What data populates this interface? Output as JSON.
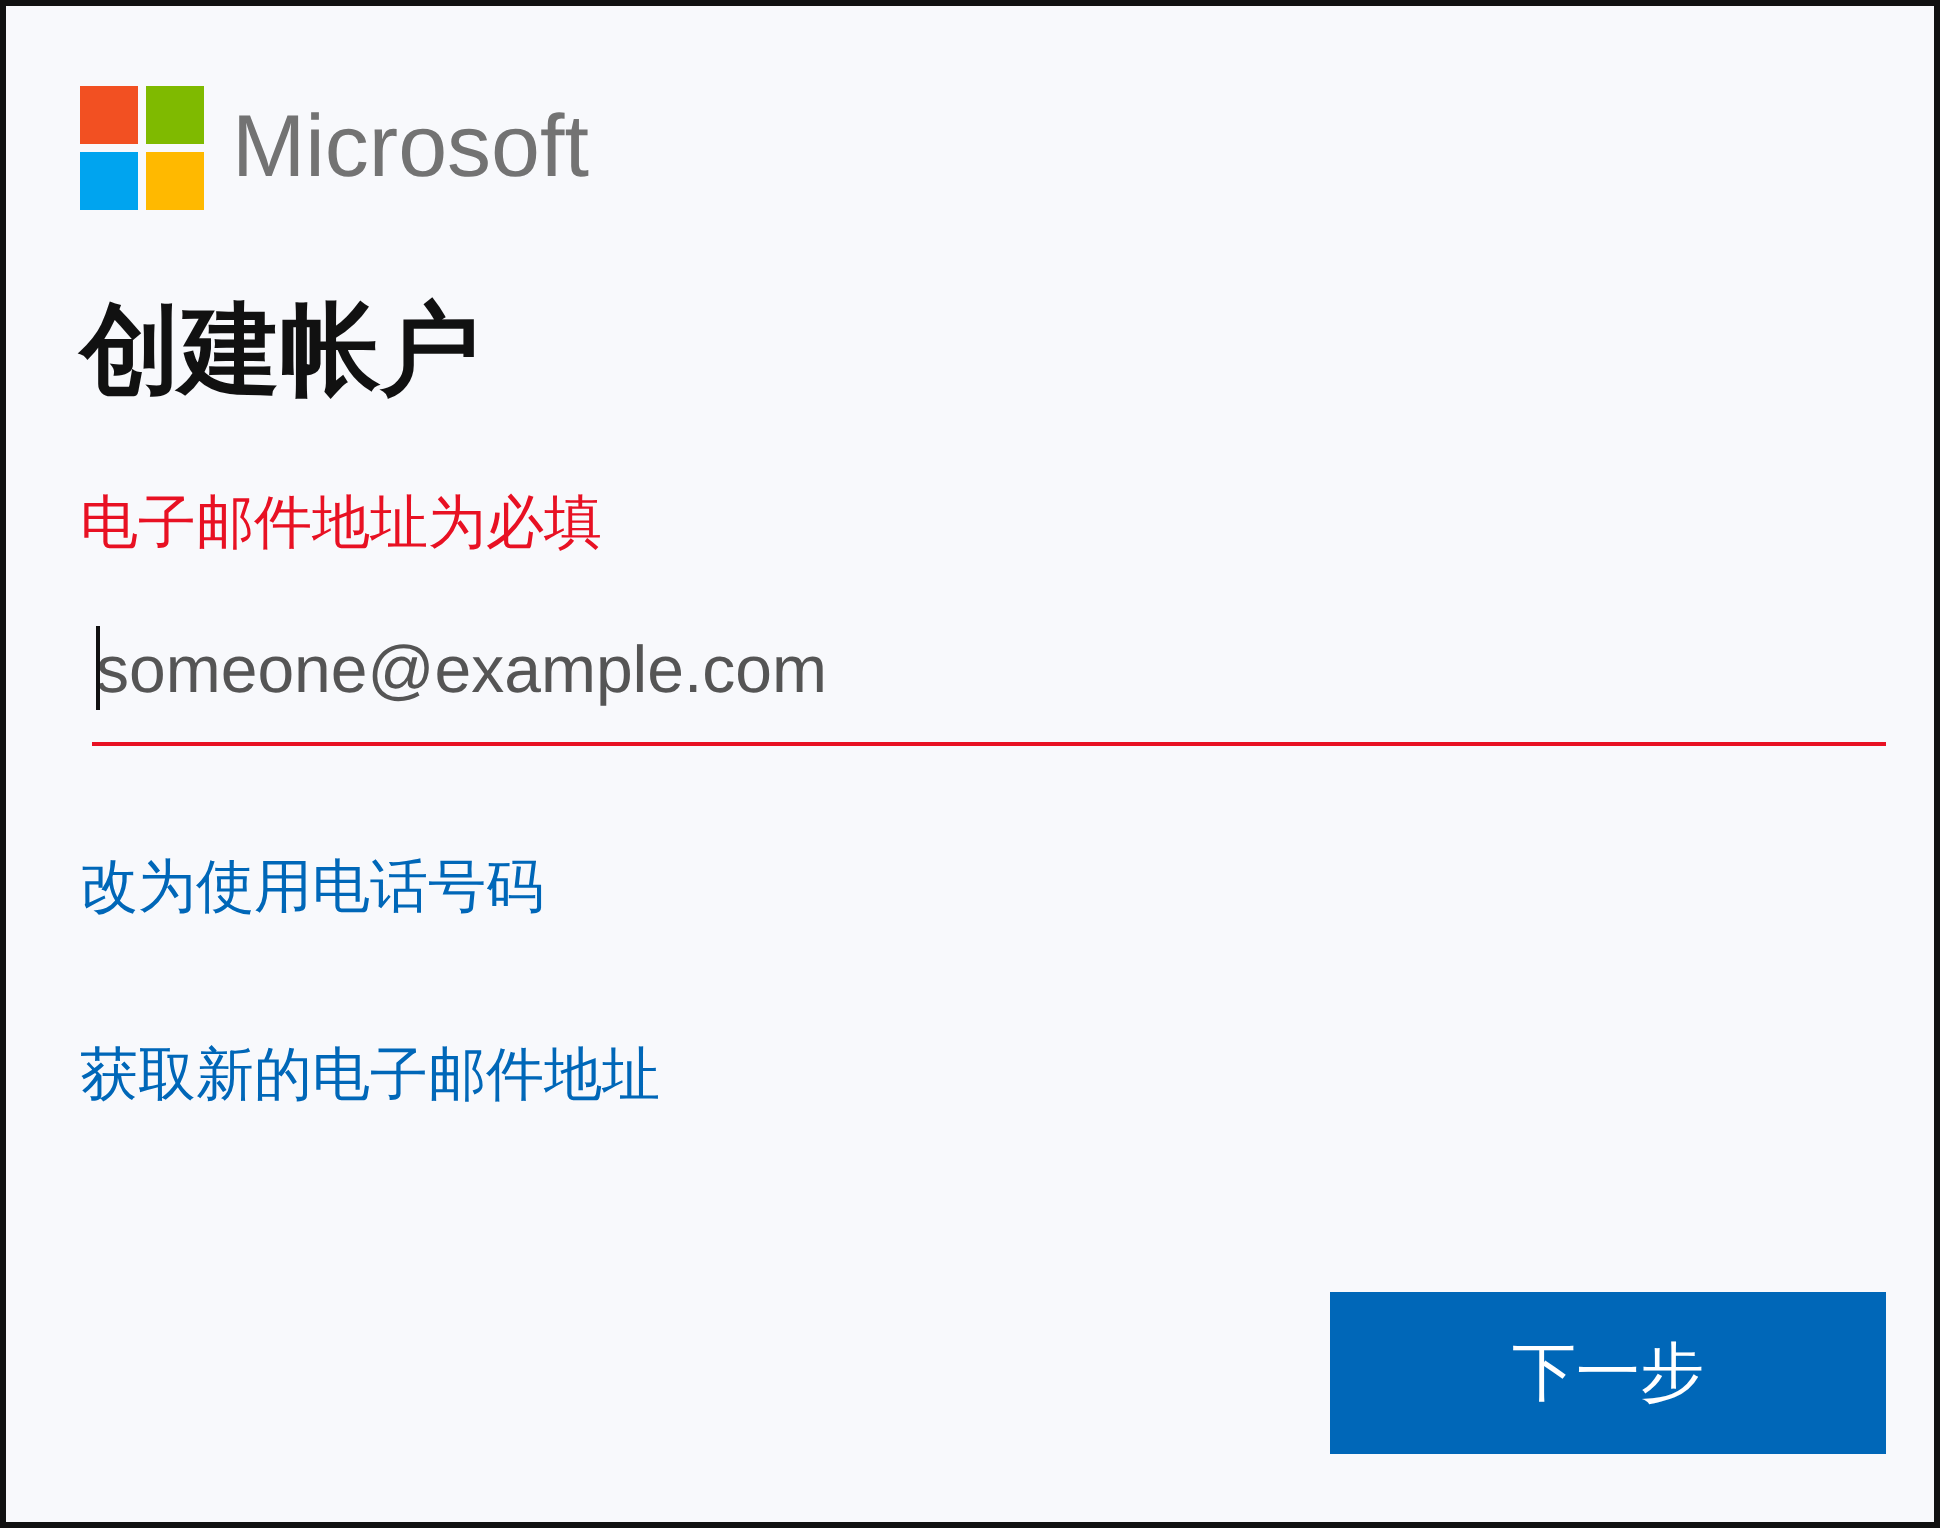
{
  "brand": {
    "name": "Microsoft"
  },
  "title": "创建帐户",
  "error_message": "电子邮件地址为必填",
  "email_field": {
    "placeholder": "someone@example.com",
    "invalid": true,
    "focused": true
  },
  "links": [
    {
      "label": "改为使用电话号码"
    },
    {
      "label": "获取新的电子邮件地址"
    }
  ],
  "next_button": {
    "label": "下一步"
  }
}
